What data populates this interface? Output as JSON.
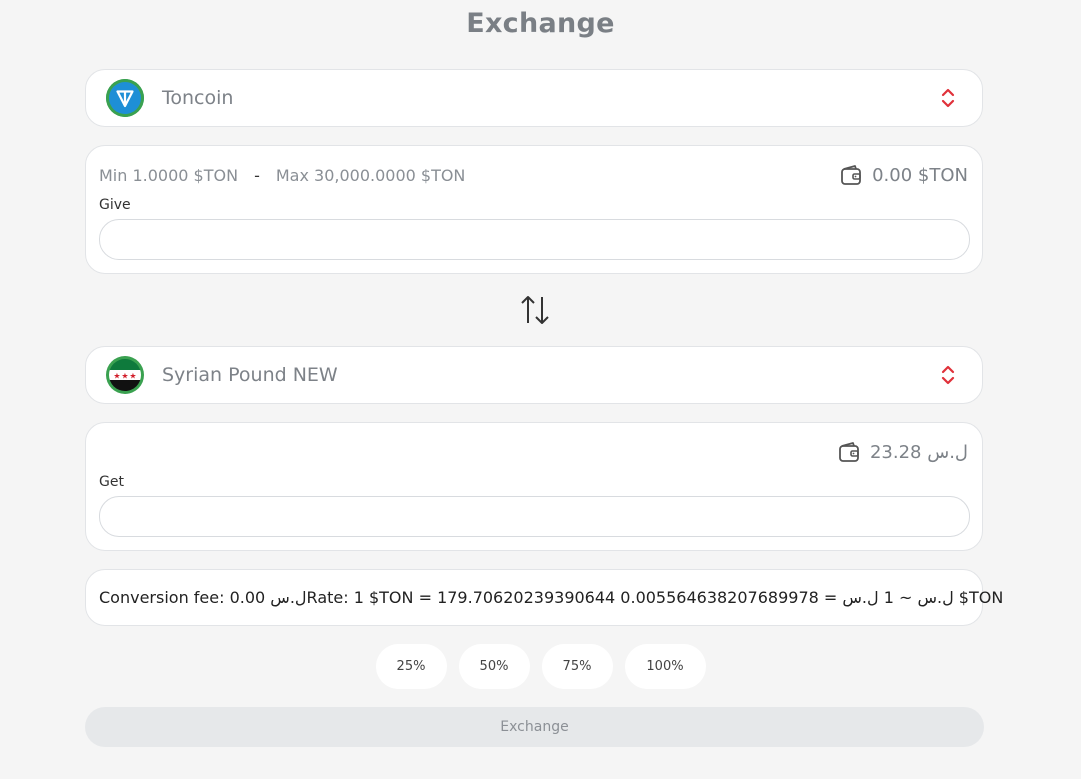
{
  "header": {
    "title": "Exchange"
  },
  "from": {
    "currency_name": "Toncoin",
    "icon": "toncoin-icon",
    "min_label": "Min 1.0000 $TON",
    "dash": "-",
    "max_label": "Max 30,000.0000 $TON",
    "balance": "0.00 $TON",
    "field_label": "Give",
    "value": "",
    "placeholder": ""
  },
  "to": {
    "currency_name": "Syrian Pound NEW",
    "icon": "syrian-flag-icon",
    "balance": "23.28 ل.س",
    "field_label": "Get",
    "value": "",
    "placeholder": ""
  },
  "info": {
    "fee": "Conversion fee: 0.00 ل.س",
    "rate": "Rate: 1 $TON = 179.70620239390644 ل.س ~ 1 ل.س = 0.005564638207689978 $TON"
  },
  "percent_buttons": [
    "25%",
    "50%",
    "75%",
    "100%"
  ],
  "actions": {
    "exchange_label": "Exchange"
  },
  "colors": {
    "accent_red": "#e0313a",
    "ton_blue": "#1e8fd6",
    "flag_green": "#0e7a3c",
    "disabled_button": "#e6e8ea"
  }
}
